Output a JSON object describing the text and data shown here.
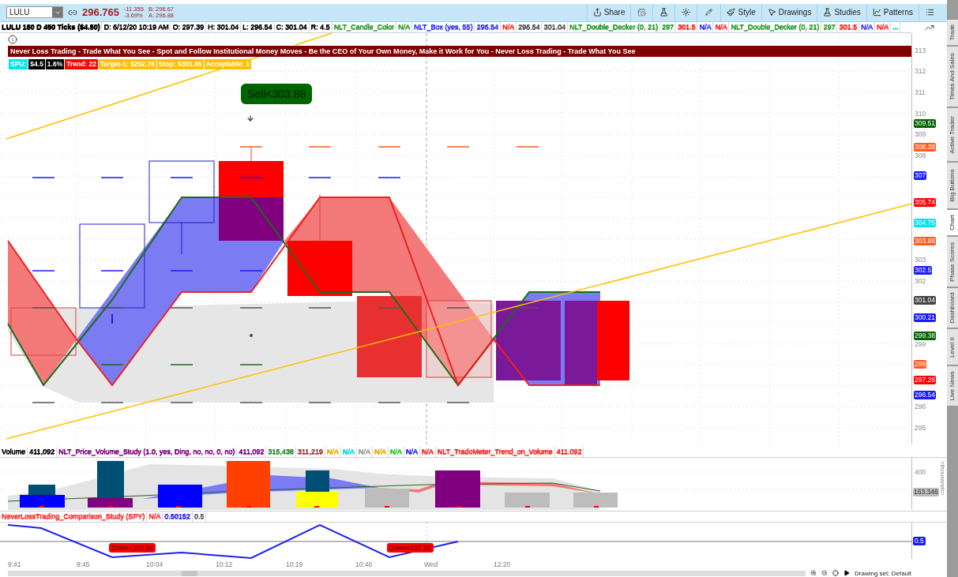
{
  "toolbar": {
    "symbol": "LULU",
    "last": "296.765",
    "change": "-11.355",
    "change_pct": "-3.69%",
    "bid": "B: 296.67",
    "ask": "A: 296.88",
    "buttons": [
      "Share",
      "Style",
      "Drawings",
      "Studies",
      "Patterns"
    ]
  },
  "info_row": [
    {
      "text": "LULU 180 D 450 Ticks ($4.50)",
      "color": "#000000"
    },
    {
      "text": "D: 6/12/20 10:19 AM",
      "color": "#000000"
    },
    {
      "text": "O: 297.39",
      "color": "#000000"
    },
    {
      "text": "H: 301.04",
      "color": "#000000"
    },
    {
      "text": "L: 296.54",
      "color": "#000000"
    },
    {
      "text": "C: 301.04",
      "color": "#000000"
    },
    {
      "text": "R: 4.5",
      "color": "#000000"
    },
    {
      "text": "NLT_Candle_Color",
      "color": "#2e9a2e"
    },
    {
      "text": "N/A",
      "color": "#2e9a2e"
    },
    {
      "text": "NLT_Box (yes, 55)",
      "color": "#3333ff"
    },
    {
      "text": "296.54",
      "color": "#3333ff"
    },
    {
      "text": "N/A",
      "color": "#ff2020"
    },
    {
      "text": "296.54",
      "color": "#555555"
    },
    {
      "text": "301.04",
      "color": "#555555"
    },
    {
      "text": "NLT_Double_Decker (0, 21)",
      "color": "#2e9a2e"
    },
    {
      "text": "297",
      "color": "#2e9a2e"
    },
    {
      "text": "301.5",
      "color": "#ff2020"
    },
    {
      "text": "N/A",
      "color": "#3333ff"
    },
    {
      "text": "N/A",
      "color": "#ff2020"
    },
    {
      "text": "NLT_Double_Decker (0, 21)",
      "color": "#2e9a2e"
    },
    {
      "text": "297",
      "color": "#2e9a2e"
    },
    {
      "text": "301.5",
      "color": "#ff2020"
    },
    {
      "text": "N/A",
      "color": "#3333ff"
    },
    {
      "text": "N/A",
      "color": "#ff2020"
    },
    {
      "text": "...",
      "color": "#33cccc"
    }
  ],
  "banner": "Never Loss Trading - Trade What You See - Spot and Follow Institutional Money Moves - Be the CEO of Your Own Money, Make it Work for You - Never Loss Trading - Trade What You See",
  "badges": [
    {
      "text": "SPU:",
      "color": "#00e5ee"
    },
    {
      "text": "$4.5",
      "color": "#000000"
    },
    {
      "text": "1.6%",
      "color": "#000000"
    },
    {
      "text": "Trend: 22",
      "color": "#ff0000"
    },
    {
      "text": "Target-1: $292.76",
      "color": "#ffc000"
    },
    {
      "text": "Stop: $301.85",
      "color": "#ffc000"
    },
    {
      "text": "Acceptable: 1",
      "color": "#ffc000"
    }
  ],
  "signal": "Sell<303.88",
  "price_axis": {
    "ticks": [
      "313",
      "312",
      "311",
      "310",
      "309",
      "308",
      "303",
      "302",
      "299",
      "296",
      "295"
    ],
    "tags": [
      {
        "label": "309.51",
        "color": "#006400"
      },
      {
        "label": "308.38",
        "color": "#ff5a1f"
      },
      {
        "label": "307",
        "color": "#1a1aff"
      },
      {
        "label": "305.74",
        "color": "#ff0000"
      },
      {
        "label": "304.75",
        "color": "#00e5ee"
      },
      {
        "label": "303.88",
        "color": "#ff5a1f"
      },
      {
        "label": "302.5",
        "color": "#1a1aff"
      },
      {
        "label": "301.04",
        "color": "#444444"
      },
      {
        "label": "300.21",
        "color": "#1a1aff"
      },
      {
        "label": "299.38",
        "color": "#006400"
      },
      {
        "label": "298",
        "color": "#ff5a1f"
      },
      {
        "label": "297.26",
        "color": "#ff0000"
      },
      {
        "label": "296.54",
        "color": "#1a1aff"
      }
    ]
  },
  "volume": {
    "header": [
      {
        "text": "Volume",
        "color": "#000000"
      },
      {
        "text": "411,092",
        "color": "#000000"
      },
      {
        "text": "NLT_Price_Volume_Study (1.0, yes, Ding, no, no, 0, no)",
        "color": "#800080"
      },
      {
        "text": "411,092",
        "color": "#800080"
      },
      {
        "text": "315,438",
        "color": "#2e8b2e"
      },
      {
        "text": "311,219",
        "color": "#a03c3c"
      },
      {
        "text": "N/A",
        "color": "#e6a800"
      },
      {
        "text": "N/A",
        "color": "#00d5e0"
      },
      {
        "text": "N/A",
        "color": "#999999"
      },
      {
        "text": "N/A",
        "color": "#e6a800"
      },
      {
        "text": "N/A",
        "color": "#22cc22"
      },
      {
        "text": "N/A",
        "color": "#2222ff"
      },
      {
        "text": "N/A",
        "color": "#ff2020"
      },
      {
        "text": "NLT_TradoMeter_Trend_on_Volume",
        "color": "#ff2020"
      },
      {
        "text": "411.092",
        "color": "#ff2020"
      }
    ],
    "tick": "400",
    "tag": "163.346",
    "unit": "<thousands>"
  },
  "comparison": {
    "header": [
      {
        "text": "NeverLossTrading_Comparison_Study (SPY)",
        "color": "#ff3030"
      },
      {
        "text": "N/A",
        "color": "#ff3030"
      },
      {
        "text": "0.50152",
        "color": "#2a2aff"
      },
      {
        "text": "0.5",
        "color": "#666666"
      }
    ],
    "signals": [
      "Down<303.88",
      "Down<297.26"
    ],
    "tag": "0.5"
  },
  "time_axis": [
    "9:41",
    "9:45",
    "10:04",
    "10:12",
    "10:19",
    "10:46",
    "Wed",
    "12:20"
  ],
  "drawing_set": "Drawing set: Default",
  "side_tabs": [
    {
      "label": "Trade",
      "selected": false
    },
    {
      "label": "Times And Sales",
      "selected": false
    },
    {
      "label": "Active Trader",
      "selected": false
    },
    {
      "label": "Big Buttons",
      "selected": false
    },
    {
      "label": "Chart",
      "selected": true
    },
    {
      "label": "Phase Scores",
      "selected": false
    },
    {
      "label": "Dashboard",
      "selected": false
    },
    {
      "label": "Level II",
      "selected": false
    },
    {
      "label": "Live News",
      "selected": false
    }
  ]
}
